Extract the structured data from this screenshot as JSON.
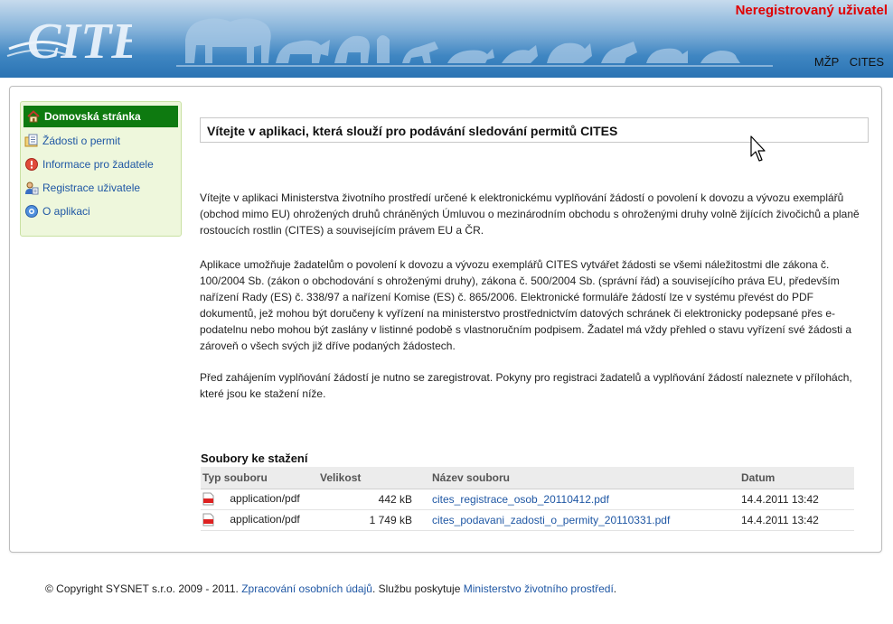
{
  "header": {
    "logo_text": "CITES",
    "user_status": "Neregistrovaný uživatel",
    "links": [
      "MŽP",
      "CITES"
    ]
  },
  "sidebar": {
    "items": [
      {
        "label": "Domovská stránka",
        "icon": "home-icon",
        "active": true
      },
      {
        "label": "Žádosti o permit",
        "icon": "folder-document-icon",
        "active": false
      },
      {
        "label": "Informace pro žadatele",
        "icon": "info-alert-icon",
        "active": false
      },
      {
        "label": "Registrace uživatele",
        "icon": "user-register-icon",
        "active": false
      },
      {
        "label": "O aplikaci",
        "icon": "help-icon",
        "active": false
      }
    ]
  },
  "main": {
    "title": "Vítejte v aplikaci, která slouží pro podávání sledování permitů CITES",
    "paragraphs": [
      "Vítejte v aplikaci Ministerstva životního prostředí určené k elektronickému vyplňování žádostí o povolení k dovozu a vývozu exemplářů (obchod mimo EU) ohrožených druhů chráněných Úmluvou o mezinárodním obchodu s ohroženými druhy volně žijících živočichů a planě rostoucích rostlin (CITES) a souvisejícím právem EU a ČR.",
      "Aplikace umožňuje žadatelům o povolení k dovozu a vývozu exemplářů CITES vytvářet žádosti se všemi náležitostmi dle zákona č. 100/2004 Sb. (zákon o obchodování s ohroženými druhy), zákona č. 500/2004 Sb. (správní řád) a souvisejícího práva EU, především nařízení Rady (ES) č. 338/97 a nařízení Komise (ES) č. 865/2006. Elektronické formuláře žádostí lze v systému převést do PDF dokumentů, jež mohou být doručeny k vyřízení na ministerstvo prostřednictvím datových schránek či elektronicky podepsané přes e-podatelnu nebo mohou být zaslány v listinné podobě s vlastnoručním podpisem. Žadatel má vždy přehled o stavu vyřízení své žádosti a zároveň o všech svých již dříve podaných žádostech.",
      "Před zahájením vyplňování žádostí je nutno se zaregistrovat. Pokyny pro registraci žadatelů a vyplňování žádostí naleznete v přílohách, které jsou ke stažení níže."
    ]
  },
  "files": {
    "title": "Soubory ke stažení",
    "columns": [
      "Typ souboru",
      "Velikost",
      "Název souboru",
      "Datum"
    ],
    "rows": [
      {
        "type": "application/pdf",
        "size": "442 kB",
        "name": "cites_registrace_osob_20110412.pdf",
        "date": "14.4.2011 13:42"
      },
      {
        "type": "application/pdf",
        "size": "1 749 kB",
        "name": "cites_podavani_zadosti_o_permity_20110331.pdf",
        "date": "14.4.2011 13:42"
      }
    ]
  },
  "footer": {
    "copyright": "© Copyright SYSNET s.r.o. 2009 - 2011.",
    "privacy_link": "Zpracování osobních údajů",
    "sep": ".",
    "provided_by": "Službu poskytuje",
    "ministry_link": "Ministerstvo životního prostředí",
    "end": "."
  }
}
